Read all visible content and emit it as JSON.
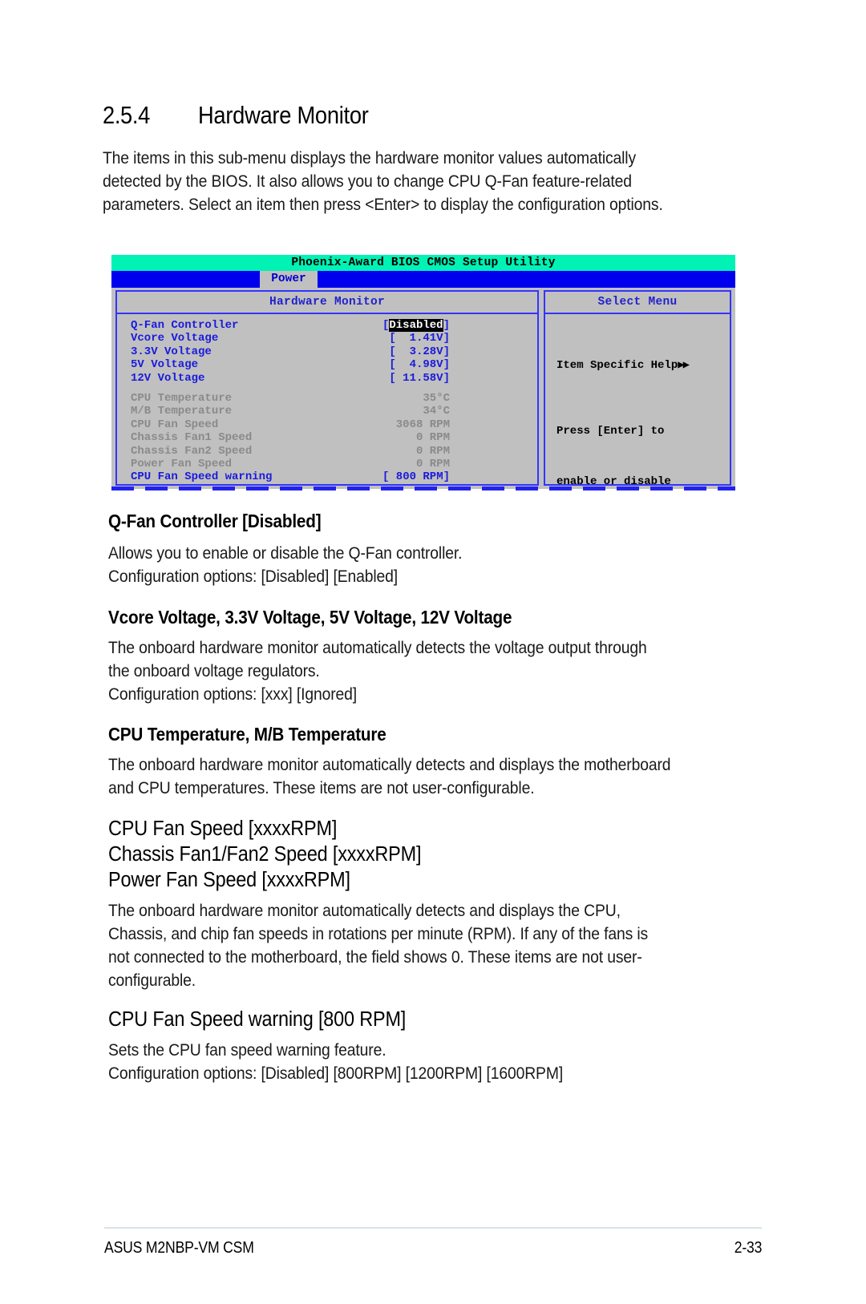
{
  "section": {
    "number": "2.5.4",
    "title": "Hardware Monitor"
  },
  "intro": {
    "line1": "The items in this sub-menu displays the hardware monitor values automatically",
    "line2": "detected by the BIOS. It also allows you to change CPU Q-Fan feature-related",
    "line3": "parameters. Select an item then press <Enter> to display the configuration options."
  },
  "bios": {
    "title": "Phoenix-Award BIOS CMOS Setup Utility",
    "active_tab": "Power",
    "left_panel_header": "Hardware Monitor",
    "right_panel_header": "Select Menu",
    "help": {
      "title": "Item Specific Help",
      "arrows": "▶▶",
      "line1": "Press [Enter] to",
      "line2": "enable or disable"
    },
    "rows": [
      {
        "label": "Q-Fan Controller",
        "value_open": "[",
        "value_hl": "Disabled",
        "value_close": "]",
        "style": "blue",
        "highlighted": true
      },
      {
        "label": "Vcore Voltage",
        "value": "[  1.41V]",
        "style": "blue"
      },
      {
        "label": "3.3V Voltage",
        "value": "[  3.28V]",
        "style": "blue"
      },
      {
        "label": "5V Voltage",
        "value": "[  4.98V]",
        "style": "blue"
      },
      {
        "label": "12V Voltage",
        "value": "[ 11.58V]",
        "style": "blue"
      },
      {
        "label": "",
        "value": "",
        "style": "spacer"
      },
      {
        "label": "CPU Temperature",
        "value": "35°C",
        "style": "gray"
      },
      {
        "label": "M/B Temperature",
        "value": "34°C",
        "style": "gray"
      },
      {
        "label": "CPU Fan Speed",
        "value": "3068 RPM",
        "style": "gray"
      },
      {
        "label": "Chassis Fan1 Speed",
        "value": "0 RPM",
        "style": "gray"
      },
      {
        "label": "Chassis Fan2 Speed",
        "value": "0 RPM",
        "style": "gray"
      },
      {
        "label": "Power Fan Speed",
        "value": "0 RPM",
        "style": "gray"
      },
      {
        "label": "CPU Fan Speed warning",
        "value": "[ 800 RPM]",
        "style": "blue"
      }
    ],
    "colors": {
      "title_bar": "#00f2b4",
      "menu_bar": "#0000ee",
      "panel_bg": "#c0c0c0",
      "border": "#3333ff",
      "item_blue": "#1a1add",
      "item_gray": "#8a8a8a"
    }
  },
  "topics": [
    {
      "heading": "Q-Fan Controller [Disabled]",
      "heading_style": "bold",
      "body": [
        "Allows you to enable or disable the Q-Fan controller.",
        "Configuration options: [Disabled] [Enabled]"
      ]
    },
    {
      "heading": "Vcore Voltage, 3.3V Voltage, 5V Voltage, 12V Voltage",
      "heading_style": "bold",
      "body": [
        "The onboard hardware monitor automatically detects the voltage output through",
        "the onboard voltage regulators.",
        "Configuration options: [xxx] [Ignored]"
      ]
    },
    {
      "heading": "CPU Temperature, M/B Temperature",
      "heading_style": "bold",
      "body": [
        "The onboard hardware monitor automatically detects and displays the motherboard",
        "and CPU temperatures. These items are not user-configurable."
      ]
    },
    {
      "heading_lines": [
        "CPU Fan Speed [xxxxRPM]",
        "Chassis Fan1/Fan2 Speed [xxxxRPM]",
        "Power Fan Speed [xxxxRPM]"
      ],
      "heading_style": "light",
      "body": [
        "The onboard hardware monitor automatically detects and displays the CPU,",
        "Chassis, and chip fan speeds in rotations per minute (RPM). If any of the fans is",
        "not connected to the motherboard, the field shows 0. These items are not user-",
        "configurable."
      ]
    },
    {
      "heading": "CPU Fan Speed warning [800 RPM]",
      "heading_style": "light",
      "body": [
        "Sets the CPU fan speed warning feature.",
        "Configuration options: [Disabled] [800RPM] [1200RPM] [1600RPM]"
      ]
    }
  ],
  "footer": {
    "left": "ASUS M2NBP-VM CSM",
    "right": "2-33"
  }
}
